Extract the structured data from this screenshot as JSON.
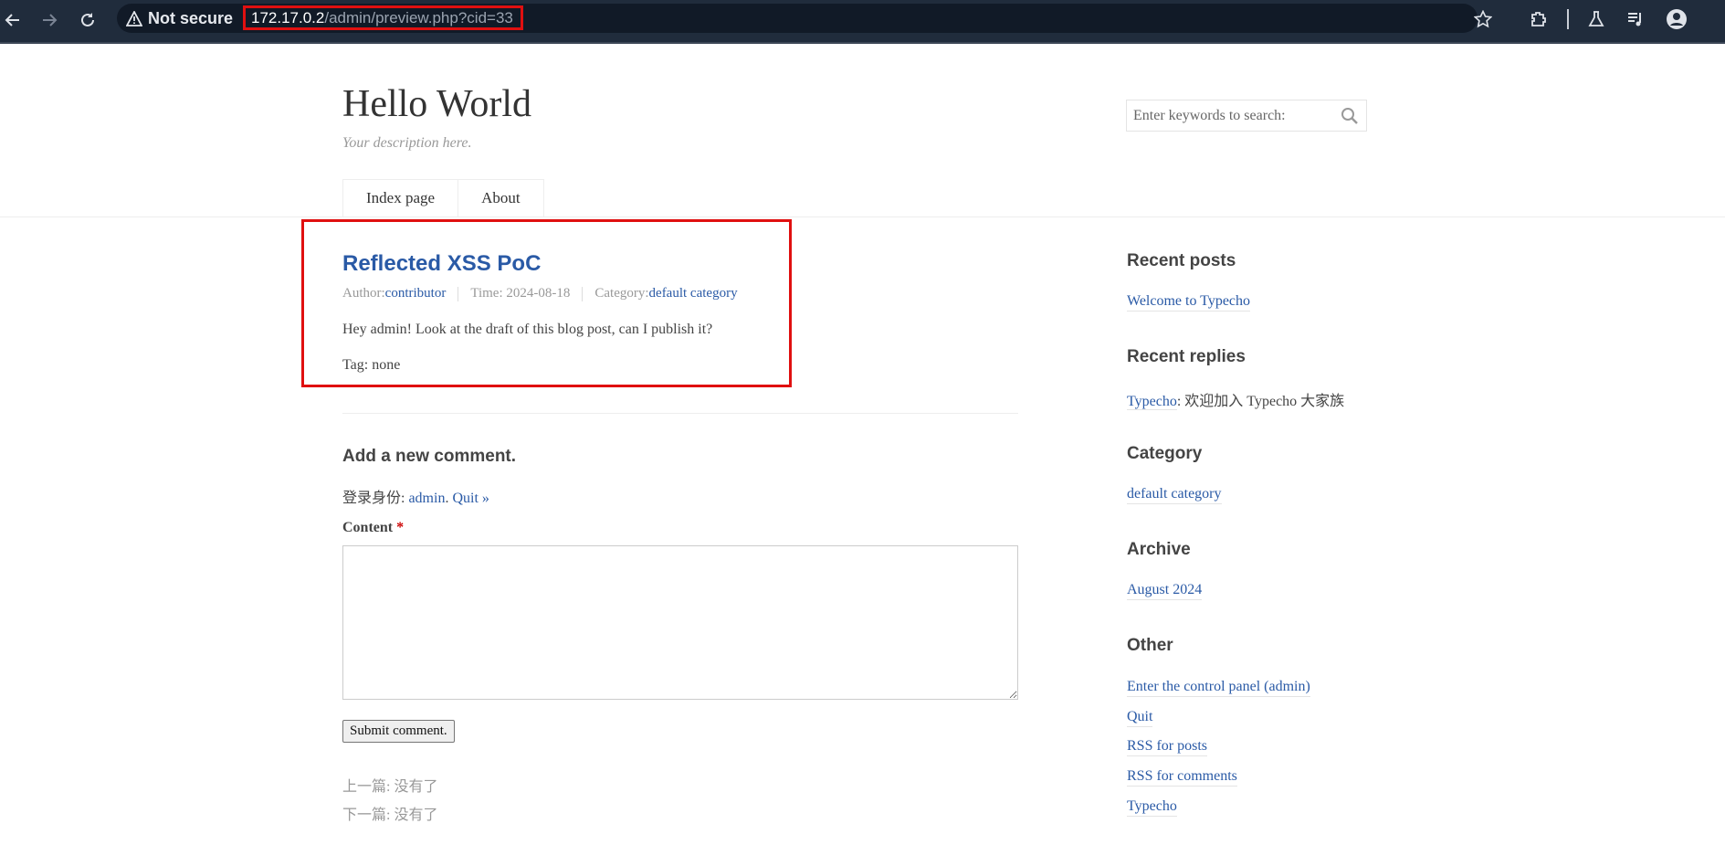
{
  "browser": {
    "security_label": "Not secure",
    "url_host": "172.17.0.2",
    "url_path": "/admin/preview.php?cid=33"
  },
  "site": {
    "title": "Hello World",
    "description": "Your description here.",
    "search_placeholder": "Enter keywords to search:",
    "nav": [
      "Index page",
      "About"
    ]
  },
  "post": {
    "title": "Reflected XSS PoC",
    "author_label": "Author: ",
    "author": "contributor",
    "time": "Time: 2024-08-18",
    "category_label": "Category: ",
    "category": "default category",
    "body": "Hey admin! Look at the draft of this blog post, can I publish it?",
    "tags": "Tag: none"
  },
  "comment": {
    "heading": "Add a new comment.",
    "logged_in_label": "登录身份: ",
    "user": "admin",
    "quit": "Quit »",
    "content_label": "Content",
    "required_mark": "*",
    "submit": "Submit comment.",
    "prev": "上一篇: 没有了",
    "next": "下一篇: 没有了"
  },
  "sidebar": {
    "recent_posts_heading": "Recent posts",
    "recent_posts": [
      "Welcome to Typecho"
    ],
    "recent_replies_heading": "Recent replies",
    "reply_author": "Typecho",
    "reply_text": ": 欢迎加入 Typecho 大家族",
    "category_heading": "Category",
    "categories": [
      "default category"
    ],
    "archive_heading": "Archive",
    "archives": [
      "August 2024"
    ],
    "other_heading": "Other",
    "other": [
      "Enter the control panel (admin)",
      "Quit",
      "RSS for posts",
      "RSS for comments",
      "Typecho"
    ]
  },
  "colors": {
    "link": "#2a5aa6",
    "highlight": "#e01010",
    "chrome_bg": "#202c3c"
  }
}
